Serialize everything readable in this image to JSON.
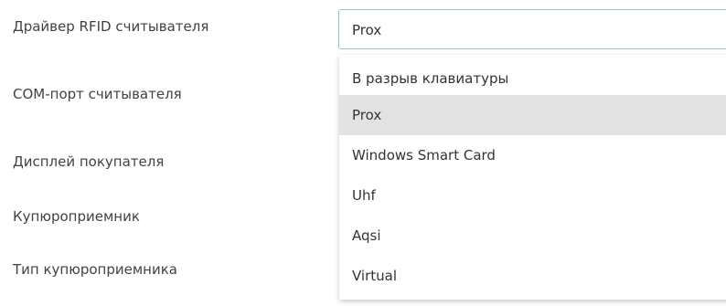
{
  "form": {
    "labels": [
      "Драйвер RFID считывателя",
      "COM-порт считывателя",
      "Дисплей покупателя",
      "Купюроприемник",
      "Тип купюроприемника"
    ]
  },
  "rfid_driver_select": {
    "value": "Prox",
    "accent_color": "#8fd19e"
  },
  "dropdown": {
    "options": [
      "В разрыв клавиатуры",
      "Prox",
      "Windows Smart Card",
      "Uhf",
      "Aqsi",
      "Virtual"
    ],
    "selected": "Prox",
    "highlight_color": "#e3e3e3"
  }
}
